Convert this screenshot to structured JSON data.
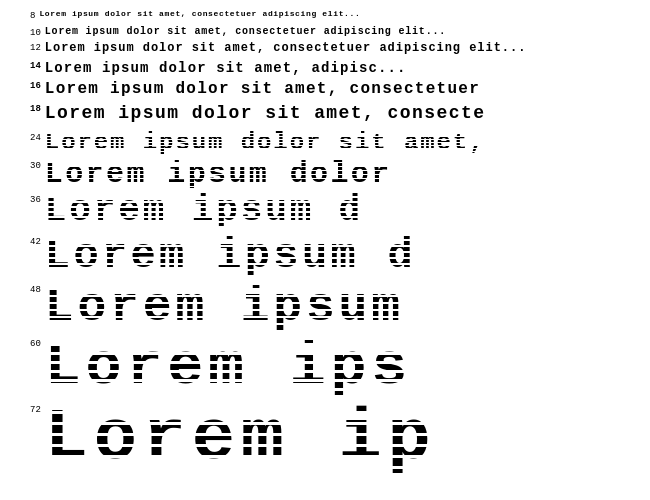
{
  "lines": {
    "small": [
      {
        "num": "8",
        "size": "8",
        "text": "Lorem ipsum dolor sit amet, consectetuer adipiscing elit..."
      },
      {
        "num": "10",
        "size": "10",
        "text": "Lorem ipsum dolor sit amet, consectetuer adipiscing elit..."
      },
      {
        "num": "12",
        "size": "12",
        "text": "Lorem ipsum dolor sit amet, consectetuer adipiscing elit..."
      },
      {
        "num": "14",
        "size": "14",
        "text": "Lorem ipsum dolor sit amet, adipisc..."
      },
      {
        "num": "16",
        "size": "16",
        "text": "Lorem ipsum dolor sit amet, consectetuer"
      },
      {
        "num": "18",
        "size": "18",
        "text": "Lorem ipsum dolor sit amet, consecte"
      }
    ],
    "large": [
      {
        "num": "24",
        "size": "24",
        "text": "Lorem ipsum dolor sit amet,"
      },
      {
        "num": "30",
        "size": "30",
        "text": "Lorem ipsum dolor"
      },
      {
        "num": "36",
        "size": "36",
        "text": "Lorem ipsum d"
      },
      {
        "num": "42",
        "size": "42",
        "text": "Lorem ipsum d"
      },
      {
        "num": "48",
        "size": "48",
        "text": "Lorem  ipsum"
      },
      {
        "num": "60",
        "size": "60",
        "text": "Lorem  ips"
      },
      {
        "num": "72",
        "size": "72",
        "text": "Lorem  ip"
      }
    ]
  }
}
